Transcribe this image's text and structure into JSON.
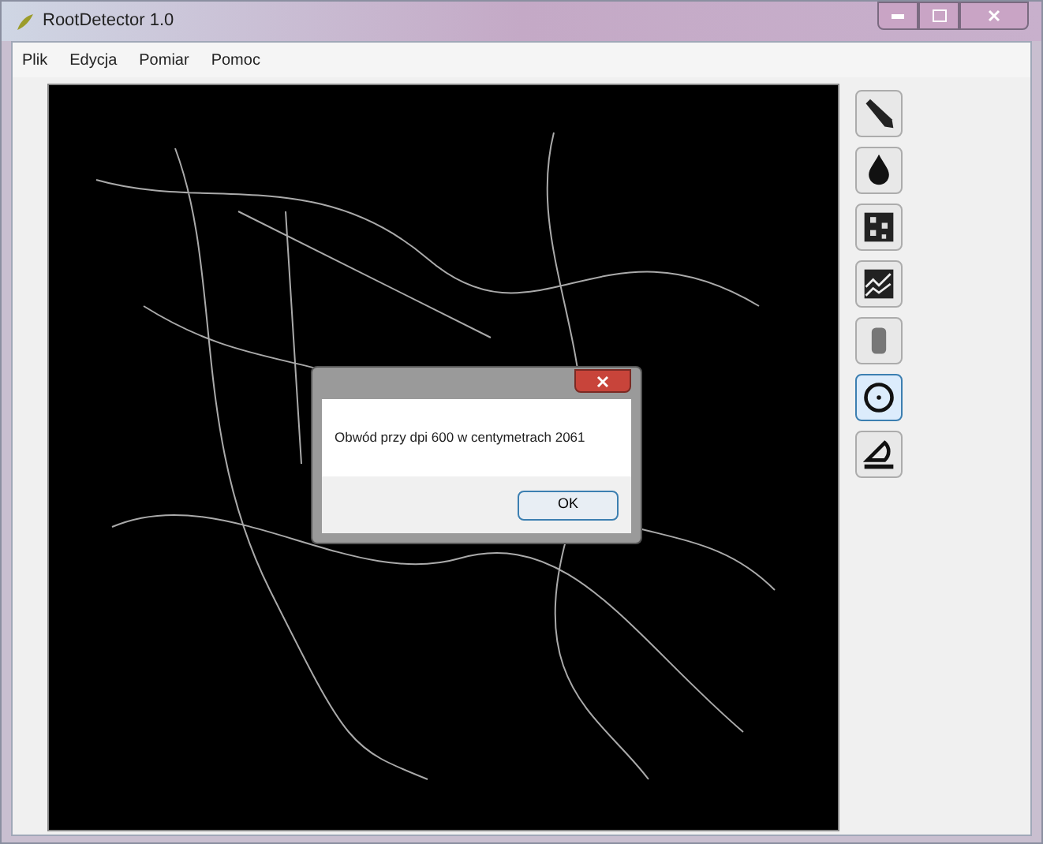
{
  "window": {
    "title": "RootDetector 1.0"
  },
  "menu": [
    "Plik",
    "Edycja",
    "Pomiar",
    "Pomoc"
  ],
  "tools": [
    {
      "kind": "pencil",
      "selected": false
    },
    {
      "kind": "drop",
      "selected": false
    },
    {
      "kind": "grid",
      "selected": false
    },
    {
      "kind": "chart",
      "selected": false
    },
    {
      "kind": "capsule",
      "selected": false
    },
    {
      "kind": "circle",
      "selected": true
    },
    {
      "kind": "protractor",
      "selected": false
    }
  ],
  "dialog": {
    "message": "Obwód przy dpi 600 w centymetrach 2061",
    "button": "OK"
  }
}
